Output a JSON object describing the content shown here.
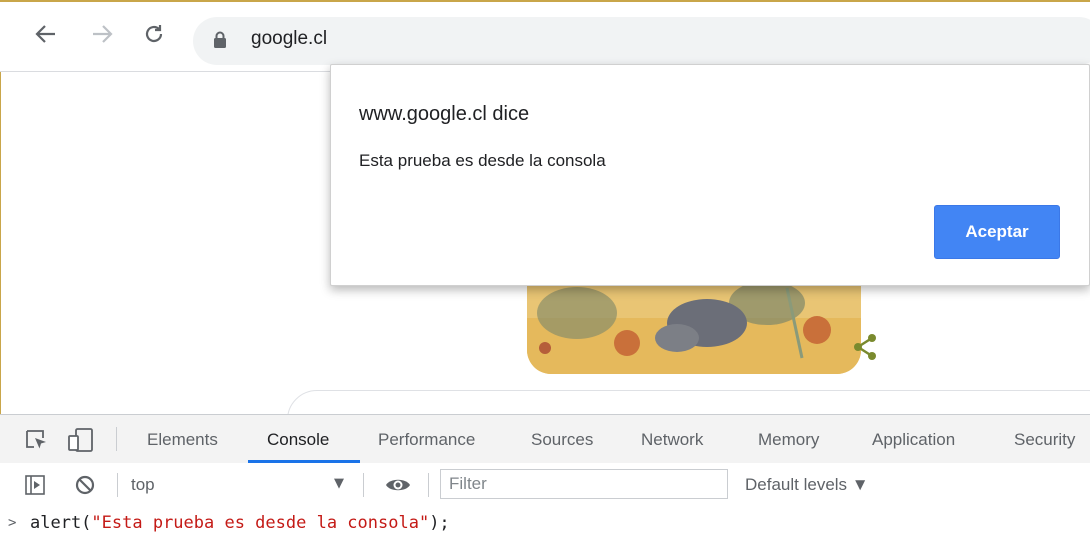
{
  "browser": {
    "url": "google.cl"
  },
  "dialog": {
    "title": "www.google.cl dice",
    "message": "Esta prueba es desde la consola",
    "accept_label": "Aceptar",
    "accent": "#4285f4"
  },
  "devtools": {
    "tabs": [
      "Elements",
      "Console",
      "Performance",
      "Sources",
      "Network",
      "Memory",
      "Application",
      "Security"
    ],
    "active_tab": "Console",
    "context": "top",
    "filter_placeholder": "Filter",
    "levels": "Default levels ▼",
    "console_prompt": ">",
    "command": {
      "prefix": "alert(",
      "string": "\"Esta prueba es desde la consola\"",
      "suffix": ");"
    },
    "accent": "#1a73e8"
  }
}
